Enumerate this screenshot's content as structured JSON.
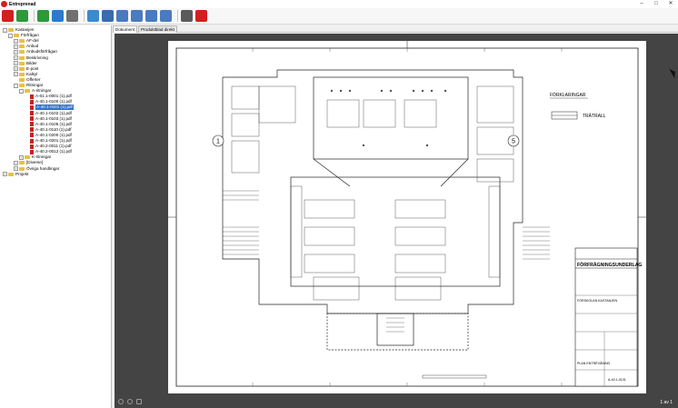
{
  "window": {
    "title": "Entreprenad"
  },
  "toolbar": {
    "icons": [
      "pdf-icon",
      "back-icon",
      "add-icon",
      "refresh-icon",
      "print-icon",
      "email-icon",
      "monitor-icon",
      "document-icon",
      "list-icon",
      "edit-icon",
      "download-icon",
      "window-icon",
      "pdf-export-icon"
    ],
    "colors": [
      "#d02020",
      "#2a9a3a",
      "#2a9a3a",
      "#2a7ad0",
      "#707070",
      "#3a8ad0",
      "#3a6ab0",
      "#4a7ac0",
      "#4a7ac0",
      "#4a7ac0",
      "#4a7ac0",
      "#5a5a5a",
      "#d02020"
    ]
  },
  "tree": [
    {
      "label": "Kastanjen",
      "level": 0,
      "type": "folder",
      "expand": "-"
    },
    {
      "label": "Förfrågan",
      "level": 1,
      "type": "folder",
      "expand": "-"
    },
    {
      "label": "AF-del",
      "level": 2,
      "type": "folder",
      "expand": "+"
    },
    {
      "label": "Anbud",
      "level": 2,
      "type": "folder",
      "expand": "+"
    },
    {
      "label": "Anbudsförfrågan",
      "level": 2,
      "type": "folder",
      "expand": "+"
    },
    {
      "label": "Beskrivning",
      "level": 2,
      "type": "folder",
      "expand": "+"
    },
    {
      "label": "Bilder",
      "level": 2,
      "type": "folder",
      "expand": "+"
    },
    {
      "label": "E-post",
      "level": 2,
      "type": "folder",
      "expand": "+"
    },
    {
      "label": "Kalkyl",
      "level": 2,
      "type": "folder",
      "expand": "+"
    },
    {
      "label": "Offerter",
      "level": 2,
      "type": "folder",
      "expand": ""
    },
    {
      "label": "Ritningar",
      "level": 2,
      "type": "folder",
      "expand": "-"
    },
    {
      "label": "A-ritningar",
      "level": 3,
      "type": "folder",
      "expand": "-"
    },
    {
      "label": "A-01.1-0001 (1).pdf",
      "level": 4,
      "type": "pdf",
      "expand": ""
    },
    {
      "label": "A-40.1-0100 (1).pdf",
      "level": 4,
      "type": "pdf",
      "expand": ""
    },
    {
      "label": "A-40.1-0101 (1).pdf",
      "level": 4,
      "type": "pdf",
      "expand": "",
      "selected": true
    },
    {
      "label": "A-40.1-0102 (1).pdf",
      "level": 4,
      "type": "pdf",
      "expand": ""
    },
    {
      "label": "A-40.1-0103 (1).pdf",
      "level": 4,
      "type": "pdf",
      "expand": ""
    },
    {
      "label": "A-40.1-0105 (1).pdf",
      "level": 4,
      "type": "pdf",
      "expand": ""
    },
    {
      "label": "A-40.1-0110 (1).pdf",
      "level": 4,
      "type": "pdf",
      "expand": ""
    },
    {
      "label": "A-40.1-0200 (1).pdf",
      "level": 4,
      "type": "pdf",
      "expand": ""
    },
    {
      "label": "A-40.1-0201 (1).pdf",
      "level": 4,
      "type": "pdf",
      "expand": ""
    },
    {
      "label": "A-40.2-0011 (1).pdf",
      "level": 4,
      "type": "pdf",
      "expand": ""
    },
    {
      "label": "A-40.2-0012 (1).pdf",
      "level": 4,
      "type": "pdf",
      "expand": ""
    },
    {
      "label": "K-ritningar",
      "level": 3,
      "type": "folder",
      "expand": "+"
    },
    {
      "label": "[Diverse]",
      "level": 2,
      "type": "folder",
      "expand": "+"
    },
    {
      "label": "Övriga handlingar",
      "level": 2,
      "type": "folder",
      "expand": "+"
    },
    {
      "label": "Projekt",
      "level": 0,
      "type": "folder",
      "expand": "+"
    }
  ],
  "tabs": [
    {
      "label": "Dokument",
      "active": true
    },
    {
      "label": "Produktblad direkt",
      "active": false
    }
  ],
  "drawing": {
    "legend_title": "FÖRKLARINGAR",
    "legend_item": "TRÄTRALL",
    "grid_left": "1",
    "grid_right": "5",
    "titleblock_heading": "FÖRFRÅGNINGSUNDERLAG",
    "titleblock_project": "FÖRSKOLAN KASTANJEN",
    "titleblock_plan": "PLAN ENTRÉVÅNING",
    "titleblock_number": "A-40.1-0101"
  },
  "viewer": {
    "page_count": "1 av 1"
  }
}
